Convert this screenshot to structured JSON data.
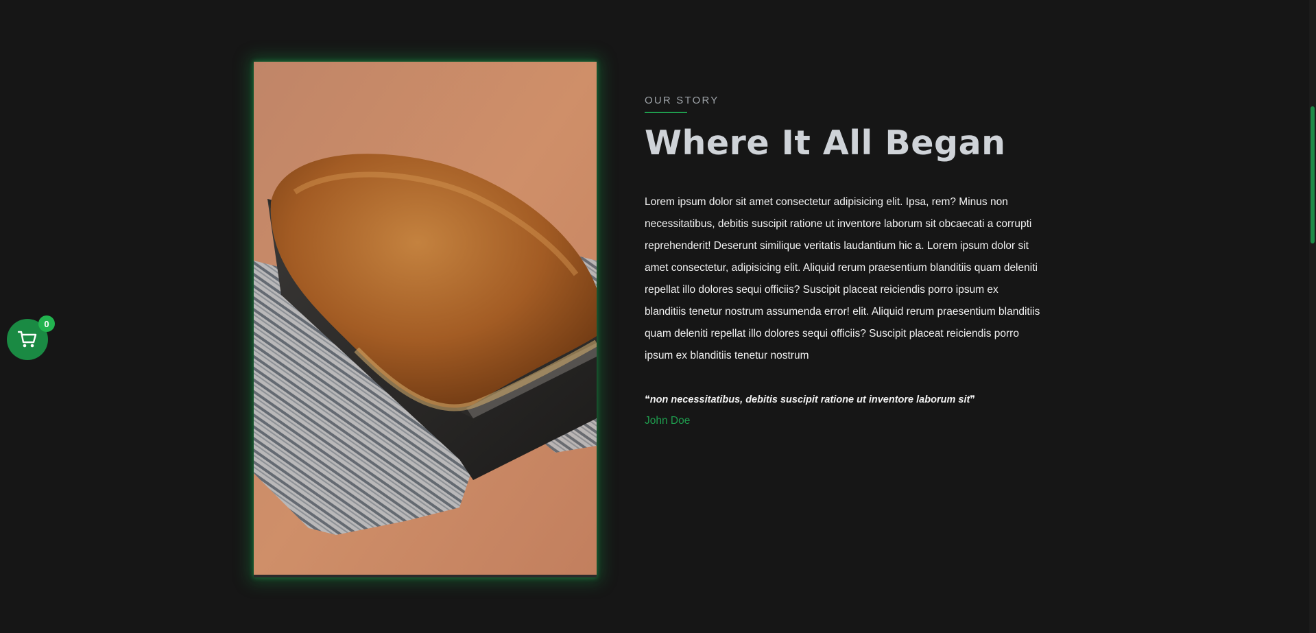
{
  "story": {
    "eyebrow": "OUR STORY",
    "headline": "Where It All Began",
    "body": "Lorem ipsum dolor sit amet consectetur adipisicing elit. Ipsa, rem? Minus non necessitatibus, debitis suscipit ratione ut inventore laborum sit obcaecati a corrupti reprehenderit! Deserunt similique veritatis laudantium hic a. Lorem ipsum dolor sit amet consectetur, adipisicing elit. Aliquid rerum praesentium blanditiis quam deleniti repellat illo dolores sequi officiis? Suscipit placeat reiciendis porro ipsum ex blanditiis tenetur nostrum assumenda error! elit. Aliquid rerum praesentium blanditiis quam deleniti repellat illo dolores sequi officiis? Suscipit placeat reiciendis porro ipsum ex blanditiis tenetur nostrum",
    "quote": "❝non necessitatibus, debitis suscipit ratione ut inventore laborum sit❞",
    "author": "John Doe"
  },
  "cart": {
    "count": "0",
    "icon": "cart-icon"
  },
  "colors": {
    "background": "#161616",
    "accent": "#1f9d4e",
    "headline": "#cfd3d8",
    "text": "#f2f2f2"
  },
  "image": {
    "subject": "bread-loaf-photo"
  }
}
